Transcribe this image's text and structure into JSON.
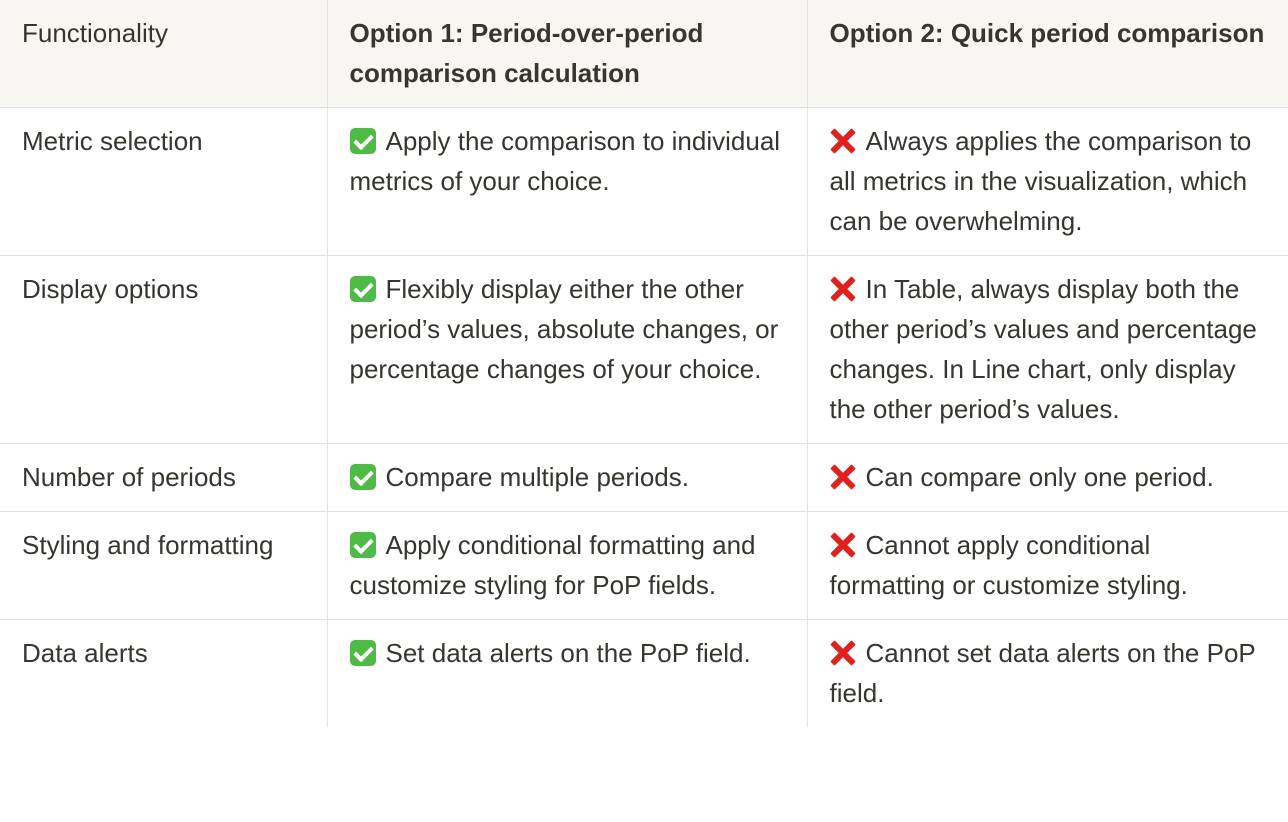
{
  "table": {
    "headers": [
      "Functionality",
      "Option 1: Period-over-period comparison calculation",
      "Option 2: Quick period comparison"
    ],
    "rows": [
      {
        "functionality": "Metric selection",
        "option1": "Apply the comparison to individual metrics of your choice.",
        "option2": "Always applies the comparison to all metrics in the visualization, which can be overwhelming."
      },
      {
        "functionality": "Display options",
        "option1": "Flexibly display either the other period’s values, absolute changes, or percentage changes of your choice.",
        "option2": "In Table, always display both the other period’s values and percentage changes. In Line chart, only display the other period’s values."
      },
      {
        "functionality": "Number of periods",
        "option1": "Compare multiple periods.",
        "option2": "Can compare only one period."
      },
      {
        "functionality": "Styling and formatting",
        "option1": "Apply conditional formatting and customize styling for PoP fields.",
        "option2": "Cannot apply conditional formatting or customize styling."
      },
      {
        "functionality": "Data alerts",
        "option1": "Set data alerts on the PoP field.",
        "option2": "Cannot set data alerts on the PoP field."
      }
    ],
    "option1_icon": "check-mark-icon",
    "option2_icon": "cross-mark-icon",
    "colors": {
      "header_background": "#f7f6f3",
      "border": "#e3e2e0",
      "text": "#37352f",
      "check": "#4fbb47",
      "cross": "#e0201c"
    }
  }
}
